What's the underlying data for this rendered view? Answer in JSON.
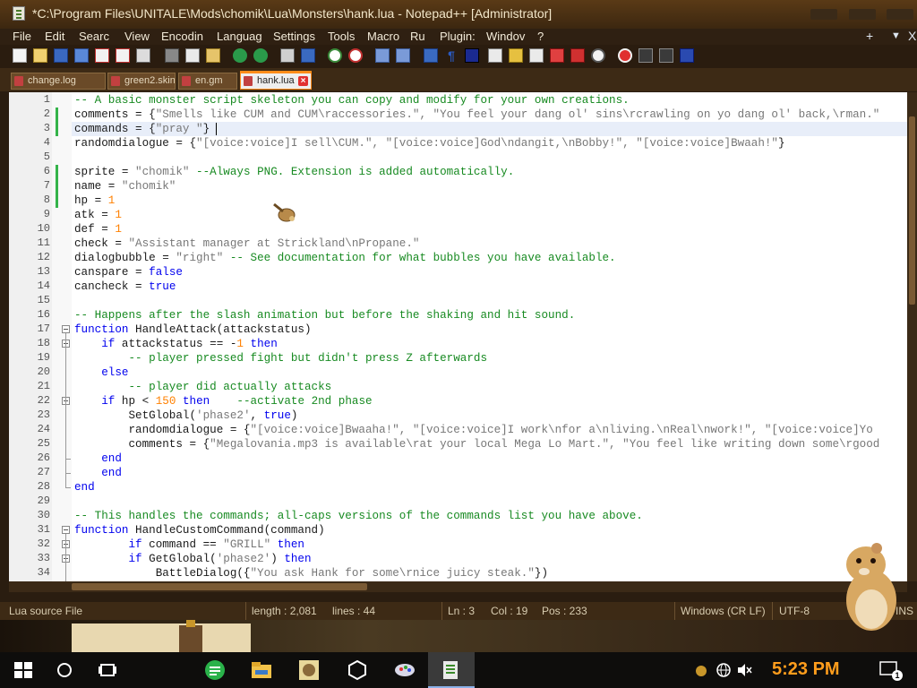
{
  "window": {
    "title": "*C:\\Program Files\\UNITALE\\Mods\\chomik\\Lua\\Monsters\\hank.lua - Notepad++ [Administrator]"
  },
  "menu": {
    "items": [
      "File",
      "Edit",
      "Searc",
      "View",
      "Encodin",
      "Languag",
      "Settings",
      "Tools",
      "Macro",
      "Ru",
      "Plugin:",
      "Windov",
      "?"
    ],
    "plus": "+",
    "down": "▼",
    "close": "X"
  },
  "tabs": [
    {
      "label": "change.log",
      "active": false
    },
    {
      "label": "green2.skin",
      "active": false
    },
    {
      "label": "en.gm",
      "active": false
    },
    {
      "label": "hank.lua",
      "active": true
    }
  ],
  "editor": {
    "line_numbers": [
      "1",
      "2",
      "3",
      "4",
      "5",
      "6",
      "7",
      "8",
      "9",
      "10",
      "11",
      "12",
      "13",
      "14",
      "15",
      "16",
      "17",
      "18",
      "19",
      "20",
      "21",
      "22",
      "23",
      "24",
      "25",
      "26",
      "27",
      "28",
      "29",
      "30",
      "31",
      "32",
      "33",
      "34"
    ],
    "code": {
      "l1": "-- A basic monster script skeleton you can copy and modify for your own creations.",
      "l2a": "comments = {",
      "l2b": "\"Smells like CUM and CUM\\raccessories.\", \"You feel your dang ol' sins\\rcrawling on yo dang ol' back,\\rman.\"",
      "l3a": "commands = {",
      "l3b": "\"pray \"",
      "l3c": "}",
      "l4a": "randomdialogue = {",
      "l4b": "\"[voice:voice]I sell\\CUM.\", \"[voice:voice]God\\ndangit,\\nBobby!\", \"[voice:voice]Bwaah!\"",
      "l4c": "}",
      "l6a": "sprite = ",
      "l6b": "\"chomik\"",
      "l6c": " --Always PNG. Extension is added automatically.",
      "l7a": "name = ",
      "l7b": "\"chomik\"",
      "l8a": "hp = ",
      "l8b": "1",
      "l9a": "atk = ",
      "l9b": "1",
      "l10a": "def = ",
      "l10b": "1",
      "l11a": "check = ",
      "l11b": "\"Assistant manager at Strickland\\nPropane.\"",
      "l12a": "dialogbubble = ",
      "l12b": "\"right\"",
      "l12c": " -- See documentation for what bubbles you have available.",
      "l13a": "canspare = ",
      "l13b": "false",
      "l14a": "cancheck = ",
      "l14b": "true",
      "l16": "-- Happens after the slash animation but before the shaking and hit sound.",
      "l17a": "function",
      "l17b": " HandleAttack(attackstatus)",
      "l18a": "    if",
      "l18b": " attackstatus == -",
      "l18c": "1",
      "l18d": " then",
      "l19": "        -- player pressed fight but didn't press Z afterwards",
      "l20": "    else",
      "l21": "        -- player did actually attacks",
      "l22a": "    if",
      "l22b": " hp < ",
      "l22c": "150",
      "l22d": " then",
      "l22e": "    --activate 2nd phase",
      "l23a": "        SetGlobal(",
      "l23b": "'phase2'",
      "l23c": ", ",
      "l23d": "true",
      "l23e": ")",
      "l24a": "        randomdialogue = {",
      "l24b": "\"[voice:voice]Bwaaha!\", \"[voice:voice]I work\\nfor a\\nliving.\\nReal\\nwork!\", \"[voice:voice]Yo",
      "l25a": "        comments = {",
      "l25b": "\"Megalovania.mp3 is available\\rat your local Mega Lo Mart.\", \"You feel like writing down some\\rgood",
      "l26": "    end",
      "l27": "    end",
      "l28": "end",
      "l30": "-- This handles the commands; all-caps versions of the commands list you have above.",
      "l31a": "function",
      "l31b": " HandleCustomCommand(command)",
      "l32a": "        if",
      "l32b": " command == ",
      "l32c": "\"GRILL\"",
      "l32d": " then",
      "l33a": "        if",
      "l33b": " GetGlobal(",
      "l33c": "'phase2'",
      "l33d": ") ",
      "l33e": "then",
      "l34a": "            BattleDialog({",
      "l34b": "\"You ask Hank for some\\rnice juicy steak.\"",
      "l34c": "})"
    }
  },
  "status": {
    "file_type": "Lua source File",
    "length": "length : 2,081",
    "lines": "lines : 44",
    "ln": "Ln : 3",
    "col": "Col : 19",
    "pos": "Pos : 233",
    "eol": "Windows (CR LF)",
    "encoding": "UTF-8",
    "mode": "INS"
  },
  "taskbar": {
    "time": "5:23 PM",
    "notification_count": "1"
  },
  "colors": {
    "accent": "#ff8c1a",
    "comment": "#178a21",
    "keyword": "#0000ee",
    "number": "#ff8000",
    "string": "#777777"
  }
}
